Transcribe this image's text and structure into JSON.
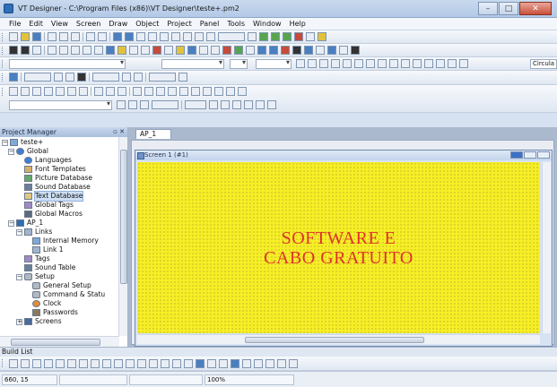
{
  "window": {
    "title": "VT Designer - C:\\Program Files (x86)\\VT Designer\\teste+.pm2",
    "minimize": "–",
    "maximize": "□",
    "close": "✕"
  },
  "menu": [
    "File",
    "Edit",
    "View",
    "Screen",
    "Draw",
    "Object",
    "Project",
    "Panel",
    "Tools",
    "Window",
    "Help"
  ],
  "toolbar": {
    "shape_dropdown_value": "Circula"
  },
  "project_manager": {
    "title": "Project Manager",
    "pin": "▫ ✕",
    "tree": [
      {
        "label": "teste+",
        "icon": "project-icon",
        "level": 0,
        "expander": "−"
      },
      {
        "label": "Global",
        "icon": "globe-icon",
        "level": 1,
        "expander": "−"
      },
      {
        "label": "Languages",
        "icon": "globe-icon",
        "level": 2
      },
      {
        "label": "Font Templates",
        "icon": "font-icon",
        "level": 2
      },
      {
        "label": "Picture Database",
        "icon": "picture-icon",
        "level": 2
      },
      {
        "label": "Sound Database",
        "icon": "sound-icon",
        "level": 2
      },
      {
        "label": "Text Database",
        "icon": "text-icon",
        "level": 2,
        "selected": true
      },
      {
        "label": "Global Tags",
        "icon": "tags-icon",
        "level": 2
      },
      {
        "label": "Global Macros",
        "icon": "macro-icon",
        "level": 2
      },
      {
        "label": "AP_1",
        "icon": "ap-icon",
        "level": 1,
        "expander": "−"
      },
      {
        "label": "Links",
        "icon": "link-icon",
        "level": 2,
        "expander": "−"
      },
      {
        "label": "Internal Memory",
        "icon": "memory-icon",
        "level": 3
      },
      {
        "label": "Link 1",
        "icon": "link-icon",
        "level": 3
      },
      {
        "label": "Tags",
        "icon": "tags-icon",
        "level": 2
      },
      {
        "label": "Sound Table",
        "icon": "sound-icon",
        "level": 2
      },
      {
        "label": "Setup",
        "icon": "gear-icon",
        "level": 2,
        "expander": "−"
      },
      {
        "label": "General Setup",
        "icon": "gear-icon",
        "level": 3
      },
      {
        "label": "Command & Statu",
        "icon": "gear-icon",
        "level": 3
      },
      {
        "label": "Clock",
        "icon": "clock-icon",
        "level": 3
      },
      {
        "label": "Passwords",
        "icon": "key-icon",
        "level": 3
      },
      {
        "label": "Screens",
        "icon": "screen-icon",
        "level": 2,
        "expander": "+"
      }
    ]
  },
  "document": {
    "tab_label": "AP_1",
    "tab_close": "×",
    "screen_window_title": "Screen 1 (#1)",
    "promo_line1": "SOFTWARE E",
    "promo_line2": "CABO GRATUITO"
  },
  "build_list": {
    "title": "Build List"
  },
  "status": {
    "coords": "660, 15",
    "zoom": "100%"
  },
  "colors": {
    "canvas": "#f7ee25",
    "promo_text": "#e0322c"
  }
}
